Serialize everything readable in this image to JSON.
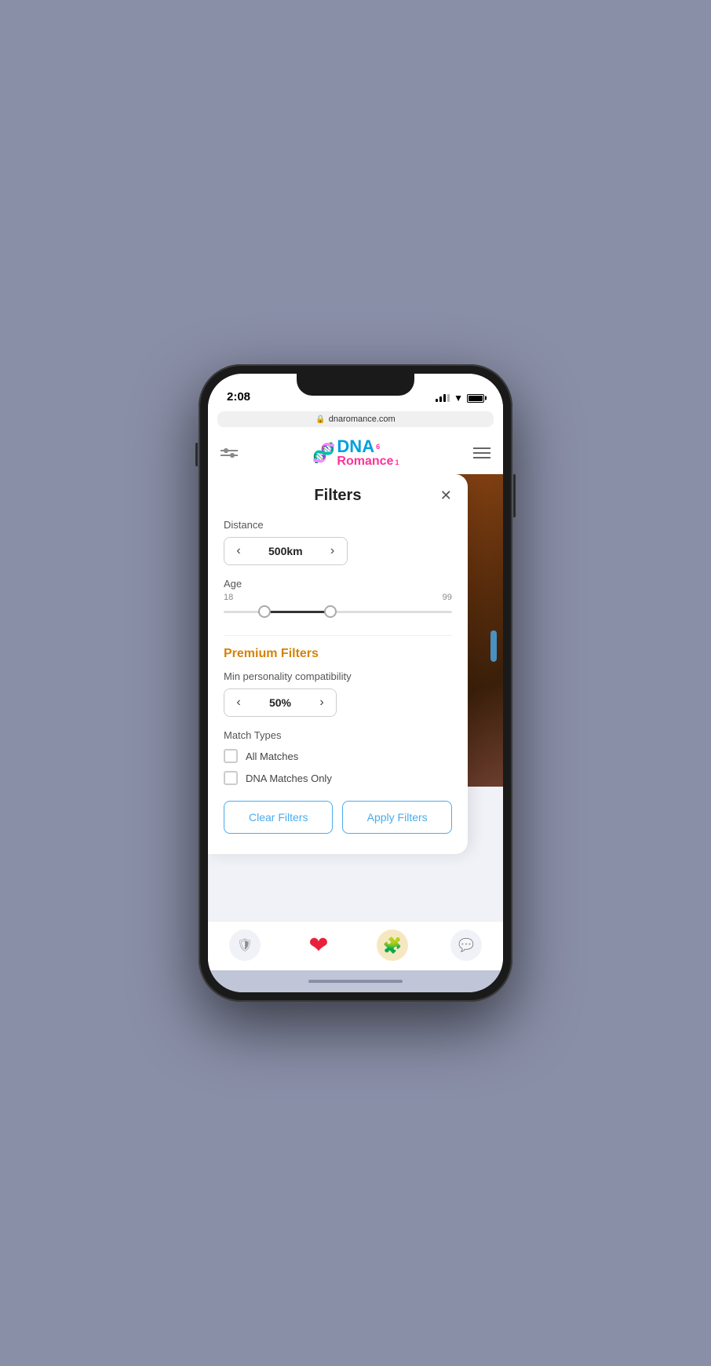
{
  "status": {
    "time": "2:08",
    "url": "dnaromance.com"
  },
  "logo": {
    "dna": "DNA",
    "romance": "Romance",
    "heart1_count": "6",
    "heart2_count": "1"
  },
  "filters": {
    "title": "Filters",
    "distance_label": "Distance",
    "distance_value": "500km",
    "age_label": "Age",
    "age_min": "18",
    "age_max": "99",
    "premium_label": "Premium Filters",
    "compat_label": "Min personality compatibility",
    "compat_value": "50%",
    "match_types_label": "Match Types",
    "match_all_label": "All Matches",
    "match_dna_label": "DNA Matches Only",
    "clear_btn": "Clear Filters",
    "apply_btn": "Apply Filters"
  },
  "nav": {
    "icon_profile": "🛡",
    "icon_heart": "❤",
    "icon_puzzle": "🧩",
    "icon_chat": "💬"
  }
}
